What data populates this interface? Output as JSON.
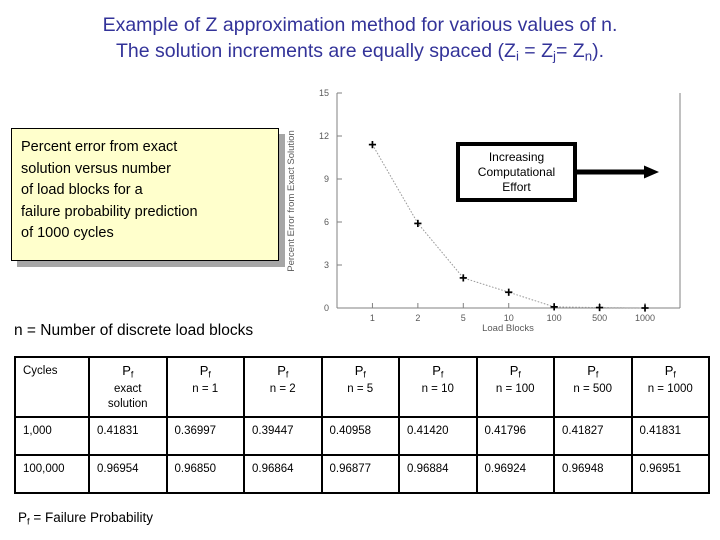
{
  "title": {
    "line1": "Example of Z approximation method for various values of n.",
    "line2_a": "The solution increments are equally spaced (Z",
    "line2_sub1": "i",
    "line2_b": " = Z",
    "line2_sub2": "j",
    "line2_c": "= Z",
    "line2_sub3": "n",
    "line2_d": ").",
    "color": "#333399"
  },
  "callout": {
    "line1": "Percent error from exact",
    "line2": "solution versus number",
    "line3": "of load blocks for a",
    "line4": "failure probability prediction",
    "line5": "of 1000 cycles",
    "fill": "#ffffcc",
    "shadow": "#a6a6a6"
  },
  "effort_box": {
    "line1": "Increasing",
    "line2": "Computational",
    "line3": "Effort",
    "arrow": "right-arrow"
  },
  "n_caption": "n = Number of discrete load blocks",
  "footnote": {
    "pf": "P",
    "sub": "f",
    "text": " = Failure Probability"
  },
  "chart_data": {
    "type": "line",
    "title": "",
    "xlabel": "Load Blocks",
    "ylabel": "Percent Error from Exact Solution",
    "categories": [
      "1",
      "2",
      "5",
      "10",
      "100",
      "500",
      "1000"
    ],
    "values": [
      11.4,
      5.9,
      2.1,
      1.1,
      0.08,
      0.03,
      0.0
    ],
    "ytick_labels": [
      "0",
      "3",
      "6",
      "9",
      "12",
      "15"
    ],
    "ytick_values": [
      0,
      3,
      6,
      9,
      12,
      15
    ],
    "ylim": [
      0,
      15
    ],
    "grid": false,
    "legend": "none",
    "marker": "plus",
    "line_style": "dotted",
    "line_color": "#999999",
    "marker_color": "#000000",
    "axis_color": "#808080"
  },
  "table": {
    "columns": [
      {
        "label": "Cycles",
        "pf": "",
        "sub": "",
        "detail": ""
      },
      {
        "label": "",
        "pf": "P",
        "sub": "f",
        "detail": "exact",
        "detail2": "solution"
      },
      {
        "label": "",
        "pf": "P",
        "sub": "f",
        "detail": "n = 1"
      },
      {
        "label": "",
        "pf": "P",
        "sub": "f",
        "detail": "n = 2"
      },
      {
        "label": "",
        "pf": "P",
        "sub": "f",
        "detail": "n = 5"
      },
      {
        "label": "",
        "pf": "P",
        "sub": "f",
        "detail": "n = 10"
      },
      {
        "label": "",
        "pf": "P",
        "sub": "f",
        "detail": "n = 100"
      },
      {
        "label": "",
        "pf": "P",
        "sub": "f",
        "detail": "n = 500"
      },
      {
        "label": "",
        "pf": "P",
        "sub": "f",
        "detail": "n = 1000"
      }
    ],
    "rows": [
      [
        "1,000",
        "0.41831",
        "0.36997",
        "0.39447",
        "0.40958",
        "0.41420",
        "0.41796",
        "0.41827",
        "0.41831"
      ],
      [
        "100,000",
        "0.96954",
        "0.96850",
        "0.96864",
        "0.96877",
        "0.96884",
        "0.96924",
        "0.96948",
        "0.96951"
      ]
    ]
  }
}
